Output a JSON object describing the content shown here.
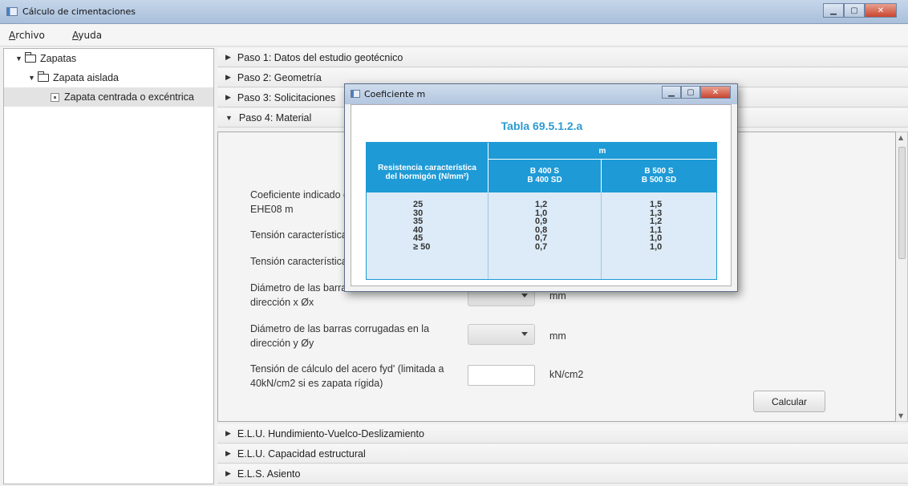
{
  "window": {
    "title": "Cálculo de cimentaciones"
  },
  "menu": {
    "archivo_first": "A",
    "archivo_rest": "rchivo",
    "ayuda_first": "A",
    "ayuda_rest": "yuda"
  },
  "tree": {
    "root": "Zapatas",
    "child": "Zapata aislada",
    "leaf": "Zapata centrada o excéntrica"
  },
  "steps": [
    {
      "label": "Paso 1: Datos del estudio geotécnico",
      "expanded": false
    },
    {
      "label": "Paso 2: Geometría",
      "expanded": false
    },
    {
      "label": "Paso 3: Solicitaciones",
      "expanded": false
    },
    {
      "label": "Paso 4: Material",
      "expanded": true
    },
    {
      "label": "E.L.U. Hundimiento-Vuelco-Deslizamiento",
      "expanded": false
    },
    {
      "label": "E.L.U. Capacidad estructural",
      "expanded": false
    },
    {
      "label": "E.L.S. Asiento",
      "expanded": false
    }
  ],
  "form": {
    "coef_label_l1": "Coeficiente indicado e",
    "coef_label_l2": "EHE08 m",
    "tension1_label": "Tensión característica",
    "tension2_label": "Tensión característica",
    "diam_x_l1": "Diámetro de las barras",
    "diam_x_l2": "dirección x  Øx",
    "diam_x_unit": "mm",
    "diam_y_l1": "Diámetro de las barras corrugadas en la",
    "diam_y_l2": "dirección y  Øy",
    "diam_y_unit": "mm",
    "fyd_l1": "Tensión de cálculo del acero fyd' (limitada a",
    "fyd_l2": "40kN/cm2 si es zapata rígida)",
    "fyd_unit": "kN/cm2",
    "fyd_value": "",
    "calc_button": "Calcular"
  },
  "dialog": {
    "title": "Coeficiente m",
    "table_title": "Tabla 69.5.1.2.a",
    "header_col1_l1": "Resistencia característica",
    "header_col1_l2": "del hormigón (N/mm²)",
    "header_m": "m",
    "header_col2_l1": "B 400 S",
    "header_col2_l2": "B 400 SD",
    "header_col3_l1": "B 500 S",
    "header_col3_l2": "B 500 SD",
    "rows": [
      {
        "fck": "25",
        "b400": "1,2",
        "b500": "1,5"
      },
      {
        "fck": "30",
        "b400": "1,0",
        "b500": "1,3"
      },
      {
        "fck": "35",
        "b400": "0,9",
        "b500": "1,2"
      },
      {
        "fck": "40",
        "b400": "0,8",
        "b500": "1,1"
      },
      {
        "fck": "45",
        "b400": "0,7",
        "b500": "1,0"
      },
      {
        "fck": "≥ 50",
        "b400": "0,7",
        "b500": "1,0"
      }
    ]
  },
  "colors": {
    "table_header_bg": "#1e9ad6",
    "table_body_bg": "#dcebf7",
    "table_title": "#2b9bd1"
  }
}
